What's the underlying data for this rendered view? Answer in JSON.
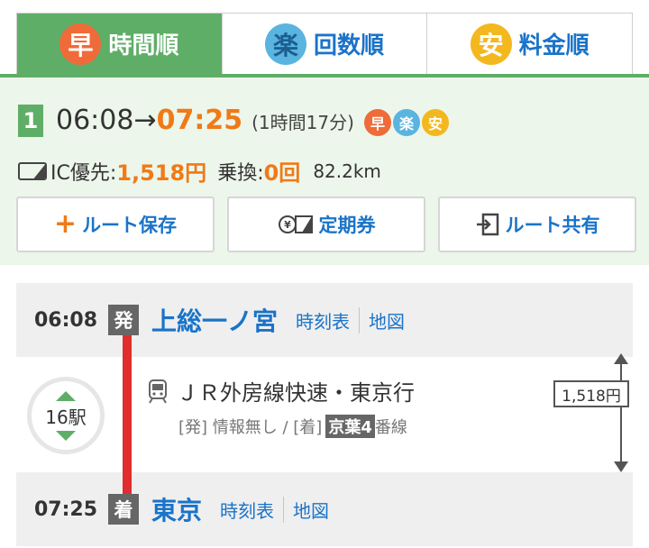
{
  "tabs": [
    {
      "icon_char": "早",
      "label": "時間順"
    },
    {
      "icon_char": "楽",
      "label": "回数順"
    },
    {
      "icon_char": "安",
      "label": "料金順"
    }
  ],
  "route": {
    "number": "1",
    "dep_time": "06:08",
    "arrow": "→",
    "arr_time": "07:25",
    "duration": "(1時間17分)",
    "badges": [
      "早",
      "楽",
      "安"
    ],
    "fare_label": "IC優先:",
    "fare": "1,518円",
    "transfer_label": "乗換:",
    "transfers": "0回",
    "distance": "82.2km"
  },
  "actions": {
    "save": "ルート保存",
    "commuter": "定期券",
    "share": "ルート共有"
  },
  "detail": {
    "departure": {
      "time": "06:08",
      "mark": "発",
      "station": "上総一ノ宮",
      "timetable": "時刻表",
      "map": "地図"
    },
    "arrival": {
      "time": "07:25",
      "mark": "着",
      "station": "東京",
      "timetable": "時刻表",
      "map": "地図"
    },
    "station_count": "16駅",
    "train": "ＪＲ外房線快速・東京行",
    "platform_prefix": "[発] 情報無し / [着]",
    "platform_tag": "京葉4",
    "platform_suffix": "番線",
    "segment_fare": "1,518円"
  },
  "colors": {
    "accent_green": "#5fae67",
    "link_blue": "#1a73c8",
    "highlight_orange": "#f07a17",
    "line_red": "#e02d2d"
  }
}
